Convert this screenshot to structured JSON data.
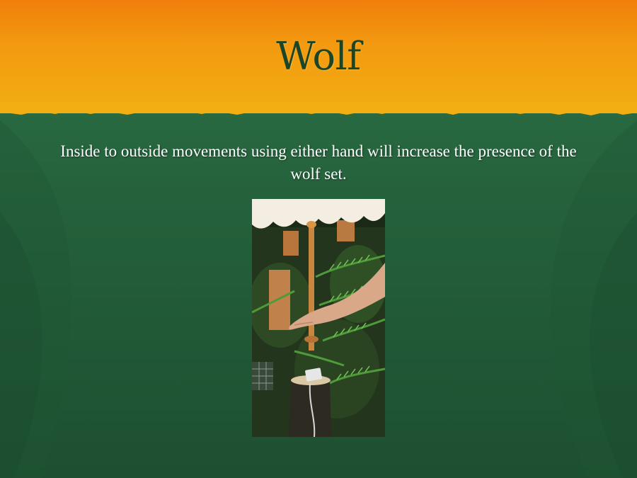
{
  "slide": {
    "title": "Wolf",
    "body": "Inside to outside movements using either hand will increase the presence of the wolf set."
  },
  "colors": {
    "header_orange": "#f39a10",
    "background_green": "#24603b",
    "title_color": "#1c4526",
    "body_text_color": "#ffffff"
  }
}
